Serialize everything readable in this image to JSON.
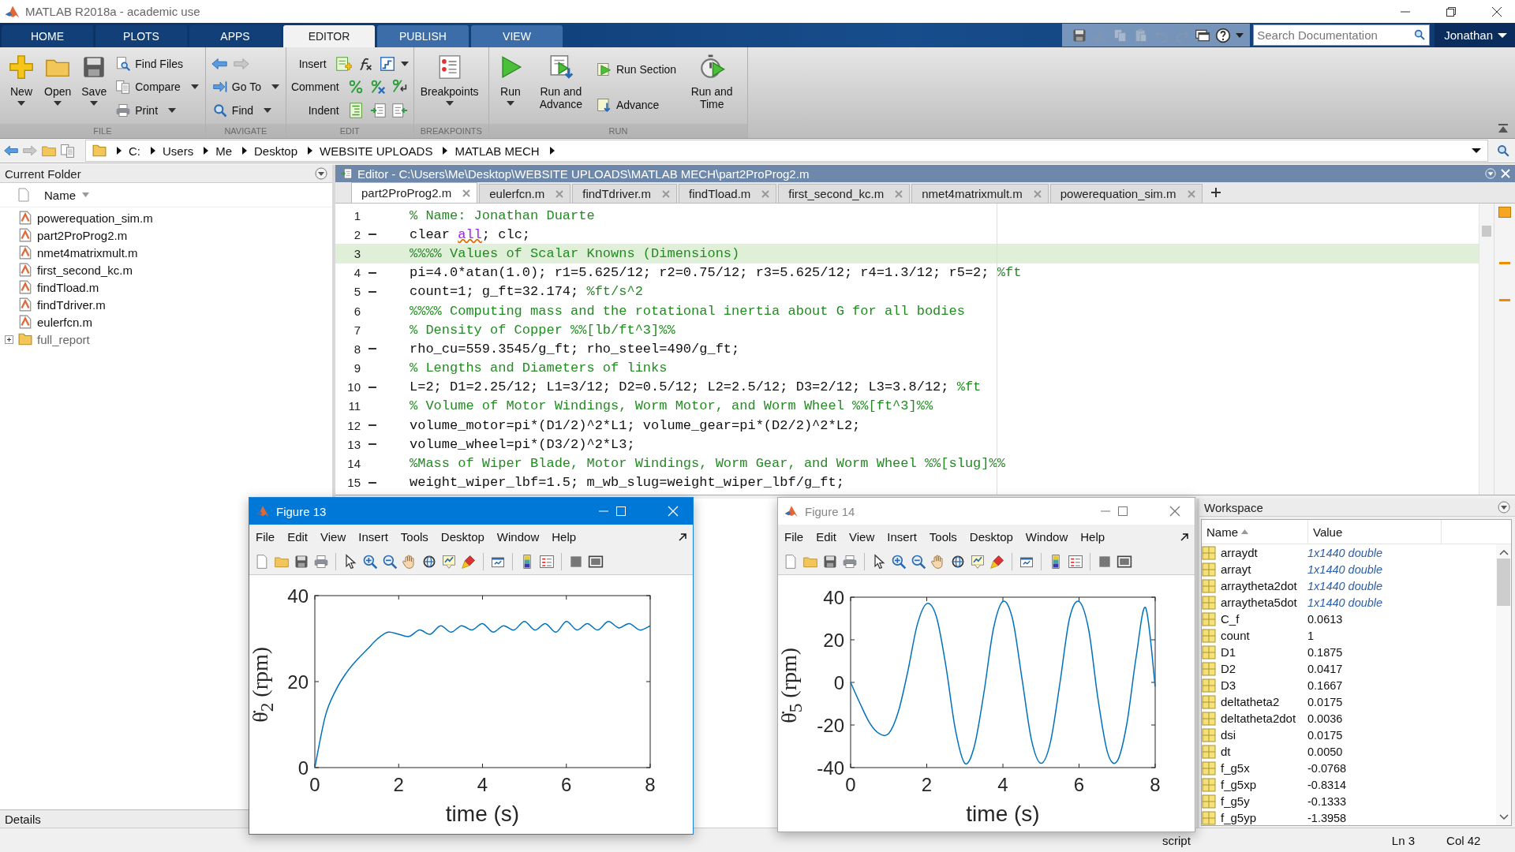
{
  "window": {
    "title": "MATLAB R2018a - academic use"
  },
  "ribbon_tabs": [
    {
      "label": "HOME",
      "selected": false,
      "contextual": false
    },
    {
      "label": "PLOTS",
      "selected": false,
      "contextual": false
    },
    {
      "label": "APPS",
      "selected": false,
      "contextual": false
    },
    {
      "label": "EDITOR",
      "selected": true,
      "contextual": true
    },
    {
      "label": "PUBLISH",
      "selected": false,
      "contextual": true
    },
    {
      "label": "VIEW",
      "selected": false,
      "contextual": true
    }
  ],
  "quick_access": [
    {
      "disabled": false
    },
    {
      "disabled": true
    },
    {
      "disabled": true
    },
    {
      "disabled": true
    },
    {
      "disabled": true
    },
    {
      "disabled": true
    },
    {
      "disabled": false
    },
    {
      "disabled": false
    }
  ],
  "search": {
    "placeholder": "Search Documentation"
  },
  "user": "Jonathan",
  "toolstrip": [
    {
      "label": "FILE",
      "columns": [
        [
          {
            "kind": "large",
            "label": "New",
            "dropdown": true
          }
        ],
        [
          {
            "kind": "large",
            "label": "Open",
            "dropdown": true
          }
        ],
        [
          {
            "kind": "large",
            "label": "Save",
            "dropdown": true
          }
        ],
        [
          {
            "kind": "small",
            "label": "Find Files",
            "dropdown": false
          },
          {
            "kind": "small",
            "label": "Compare",
            "dropdown": true
          },
          {
            "kind": "small",
            "label": "Print",
            "dropdown": true
          }
        ]
      ]
    },
    {
      "label": "NAVIGATE",
      "columns": [
        [
          {
            "kind": "icons"
          },
          {
            "kind": "small",
            "label": "Go To",
            "dropdown": true
          },
          {
            "kind": "small",
            "label": "Find",
            "dropdown": true
          }
        ]
      ]
    },
    {
      "label": "EDIT",
      "columns": [
        [
          {
            "kind": "labeled",
            "label": "Insert",
            "dropdown": true
          },
          {
            "kind": "labeled",
            "label": "Comment",
            "dropdown": false
          },
          {
            "kind": "labeled",
            "label": "Indent",
            "dropdown": false
          }
        ]
      ]
    },
    {
      "label": "BREAKPOINTS",
      "columns": [
        [
          {
            "kind": "large",
            "label": "Breakpoints",
            "dropdown": true
          }
        ]
      ]
    },
    {
      "label": "RUN",
      "columns": [
        [
          {
            "kind": "large",
            "label": "Run",
            "dropdown": true
          }
        ],
        [
          {
            "kind": "large",
            "label": "Run and Advance",
            "dropdown": false
          }
        ],
        [
          {
            "kind": "small",
            "label": "Run Section",
            "dropdown": false
          },
          {
            "kind": "small",
            "label": "Advance",
            "dropdown": false
          }
        ],
        [
          {
            "kind": "large",
            "label": "Run and Time",
            "dropdown": false
          }
        ]
      ]
    }
  ],
  "address": [
    "C:",
    "Users",
    "Me",
    "Desktop",
    "WEBSITE UPLOADS",
    "MATLAB MECH"
  ],
  "current_folder": {
    "title": "Current Folder",
    "column": "Name",
    "items": [
      {
        "name": "powerequation_sim.m",
        "kind": "file"
      },
      {
        "name": "part2ProProg2.m",
        "kind": "file"
      },
      {
        "name": "nmet4matrixmult.m",
        "kind": "file"
      },
      {
        "name": "first_second_kc.m",
        "kind": "file"
      },
      {
        "name": "findTload.m",
        "kind": "file"
      },
      {
        "name": "findTdriver.m",
        "kind": "file"
      },
      {
        "name": "eulerfcn.m",
        "kind": "file"
      },
      {
        "name": "full_report",
        "kind": "folder"
      }
    ],
    "details": "Details"
  },
  "editor": {
    "title": "Editor - C:\\Users\\Me\\Desktop\\WEBSITE UPLOADS\\MATLAB MECH\\part2ProProg2.m",
    "tabs": [
      {
        "label": "part2ProProg2.m",
        "selected": true
      },
      {
        "label": "eulerfcn.m",
        "selected": false
      },
      {
        "label": "findTdriver.m",
        "selected": false
      },
      {
        "label": "findTload.m",
        "selected": false
      },
      {
        "label": "first_second_kc.m",
        "selected": false
      },
      {
        "label": "nmet4matrixmult.m",
        "selected": false
      },
      {
        "label": "powerequation_sim.m",
        "selected": false
      }
    ],
    "lines": [
      {
        "number": "1",
        "exec": false,
        "highlighted": false,
        "segments": [
          {
            "kind": "comment",
            "text": "% Name: Jonathan Duarte"
          }
        ]
      },
      {
        "number": "2",
        "exec": true,
        "highlighted": false,
        "segments": [
          {
            "kind": "code",
            "text": "clear "
          },
          {
            "kind": "string",
            "text": "all"
          },
          {
            "kind": "code",
            "text": "; clc;"
          }
        ]
      },
      {
        "number": "3",
        "exec": false,
        "highlighted": true,
        "segments": [
          {
            "kind": "comment",
            "text": "%%%% Values of Scalar Knowns (Dimensions)"
          }
        ]
      },
      {
        "number": "4",
        "exec": true,
        "highlighted": false,
        "segments": [
          {
            "kind": "code",
            "text": "pi=4.0*atan(1.0); r1=5.625/12; r2=0.75/12; r3=5.625/12; r4=1.3/12; r5=2; "
          },
          {
            "kind": "comment",
            "text": "%ft"
          }
        ]
      },
      {
        "number": "5",
        "exec": true,
        "highlighted": false,
        "segments": [
          {
            "kind": "code",
            "text": "count=1; g_ft=32.174; "
          },
          {
            "kind": "comment",
            "text": "%ft/s^2"
          }
        ]
      },
      {
        "number": "6",
        "exec": false,
        "highlighted": false,
        "segments": [
          {
            "kind": "comment",
            "text": "%%%% Computing mass and the rotational inertia about G for all bodies"
          }
        ]
      },
      {
        "number": "7",
        "exec": false,
        "highlighted": false,
        "segments": [
          {
            "kind": "comment",
            "text": "% Density of Copper %%[lb/ft^3]%%"
          }
        ]
      },
      {
        "number": "8",
        "exec": true,
        "highlighted": false,
        "segments": [
          {
            "kind": "code",
            "text": "rho_cu=559.3545/g_ft; rho_steel=490/g_ft;"
          }
        ]
      },
      {
        "number": "9",
        "exec": false,
        "highlighted": false,
        "segments": [
          {
            "kind": "comment",
            "text": "% Lengths and Diameters of links"
          }
        ]
      },
      {
        "number": "10",
        "exec": true,
        "highlighted": false,
        "segments": [
          {
            "kind": "code",
            "text": "L=2; D1=2.25/12; L1=3/12; D2=0.5/12; L2=2.5/12; D3=2/12; L3=3.8/12; "
          },
          {
            "kind": "comment",
            "text": "%ft"
          }
        ]
      },
      {
        "number": "11",
        "exec": false,
        "highlighted": false,
        "segments": [
          {
            "kind": "comment",
            "text": "% Volume of Motor Windings, Worm Motor, and Worm Wheel %%[ft^3]%%"
          }
        ]
      },
      {
        "number": "12",
        "exec": true,
        "highlighted": false,
        "segments": [
          {
            "kind": "code",
            "text": "volume_motor=pi*(D1/2)^2*L1; volume_gear=pi*(D2/2)^2*L2;"
          }
        ]
      },
      {
        "number": "13",
        "exec": true,
        "highlighted": false,
        "segments": [
          {
            "kind": "code",
            "text": "volume_wheel=pi*(D3/2)^2*L3;"
          }
        ]
      },
      {
        "number": "14",
        "exec": false,
        "highlighted": false,
        "segments": [
          {
            "kind": "comment",
            "text": "%Mass of Wiper Blade, Motor Windings, Worm Gear, and Worm Wheel %%[slug]%%"
          }
        ]
      },
      {
        "number": "15",
        "exec": true,
        "highlighted": false,
        "segments": [
          {
            "kind": "code",
            "text": "weight_wiper_lbf=1.5; m_wb_slug=weight_wiper_lbf/g_ft;"
          }
        ]
      }
    ]
  },
  "figures": [
    {
      "title": "Figure 13",
      "focused": true,
      "menu": [
        "File",
        "Edit",
        "View",
        "Insert",
        "Tools",
        "Desktop",
        "Window",
        "Help"
      ],
      "chart_data": {
        "type": "line",
        "xlabel": "time (s)",
        "ylabel": "θ̇$_{2}$ (rpm)",
        "xlim": [
          0,
          8
        ],
        "ylim": [
          0,
          40
        ],
        "xticks": [
          0,
          2,
          4,
          6,
          8
        ],
        "yticks": [
          0,
          20,
          40
        ],
        "x": [
          0,
          0.25,
          0.5,
          0.75,
          1,
          1.25,
          1.5,
          1.75,
          2,
          2.25,
          2.5,
          2.75,
          3,
          3.25,
          3.5,
          3.75,
          4,
          4.25,
          4.5,
          4.75,
          5,
          5.25,
          5.5,
          5.75,
          6,
          6.25,
          6.5,
          6.75,
          7,
          7.25,
          7.5,
          7.75,
          8
        ],
        "series": [
          {
            "color": "#0072bd",
            "values": [
              0,
              12,
              18,
              22,
              25,
              27.5,
              30,
              31.5,
              31,
              30.5,
              32,
              31,
              33,
              31.5,
              33,
              32,
              33.5,
              31.5,
              33,
              32,
              34,
              32,
              33.5,
              31.5,
              34,
              32,
              33.5,
              32,
              34,
              32.5,
              33.5,
              32,
              33
            ]
          }
        ]
      }
    },
    {
      "title": "Figure 14",
      "focused": false,
      "menu": [
        "File",
        "Edit",
        "View",
        "Insert",
        "Tools",
        "Desktop",
        "Window",
        "Help"
      ],
      "chart_data": {
        "type": "line",
        "xlabel": "time (s)",
        "ylabel": "θ̇$_{5}$ (rpm)",
        "xlim": [
          0,
          8
        ],
        "ylim": [
          -40,
          40
        ],
        "xticks": [
          0,
          2,
          4,
          6,
          8
        ],
        "yticks": [
          -40,
          -20,
          0,
          20,
          40
        ],
        "x": [
          0,
          0.25,
          0.5,
          0.75,
          1,
          1.25,
          1.5,
          1.75,
          2,
          2.25,
          2.5,
          2.75,
          3,
          3.25,
          3.5,
          3.75,
          4,
          4.25,
          4.5,
          4.75,
          5,
          5.25,
          5.5,
          5.75,
          6,
          6.25,
          6.5,
          6.75,
          7,
          7.25,
          7.5,
          7.75,
          8
        ],
        "series": [
          {
            "color": "#0072bd",
            "values": [
              0,
              -10,
              -19,
              -24,
              -24,
              -14,
              5,
              27,
              37,
              31,
              8,
              -22,
              -38,
              -30,
              -5,
              25,
              38,
              30,
              2,
              -27,
              -38,
              -28,
              0,
              30,
              38,
              25,
              -8,
              -33,
              -37,
              -20,
              12,
              35,
              -2
            ]
          }
        ]
      }
    }
  ],
  "workspace": {
    "title": "Workspace",
    "columns": [
      "Name",
      "Value"
    ],
    "rows": [
      {
        "name": "arraydt",
        "value": "1x1440 double",
        "kind": "array"
      },
      {
        "name": "arrayt",
        "value": "1x1440 double",
        "kind": "array"
      },
      {
        "name": "arraytheta2dot",
        "value": "1x1440 double",
        "kind": "array"
      },
      {
        "name": "arraytheta5dot",
        "value": "1x1440 double",
        "kind": "array"
      },
      {
        "name": "C_f",
        "value": "0.0613",
        "kind": "scalar"
      },
      {
        "name": "count",
        "value": "1",
        "kind": "scalar"
      },
      {
        "name": "D1",
        "value": "0.1875",
        "kind": "scalar"
      },
      {
        "name": "D2",
        "value": "0.0417",
        "kind": "scalar"
      },
      {
        "name": "D3",
        "value": "0.1667",
        "kind": "scalar"
      },
      {
        "name": "deltatheta2",
        "value": "0.0175",
        "kind": "scalar"
      },
      {
        "name": "deltatheta2dot",
        "value": "0.0036",
        "kind": "scalar"
      },
      {
        "name": "dsi",
        "value": "0.0175",
        "kind": "scalar"
      },
      {
        "name": "dt",
        "value": "0.0050",
        "kind": "scalar"
      },
      {
        "name": "f_g5x",
        "value": "-0.0768",
        "kind": "scalar"
      },
      {
        "name": "f_g5xp",
        "value": "-0.8314",
        "kind": "scalar"
      },
      {
        "name": "f_g5y",
        "value": "-0.1333",
        "kind": "scalar"
      },
      {
        "name": "f_g5yp",
        "value": "-1.3958",
        "kind": "scalar"
      }
    ]
  },
  "status_bar": {
    "mode": "script",
    "line": "Ln 3",
    "column": "Col 42"
  }
}
